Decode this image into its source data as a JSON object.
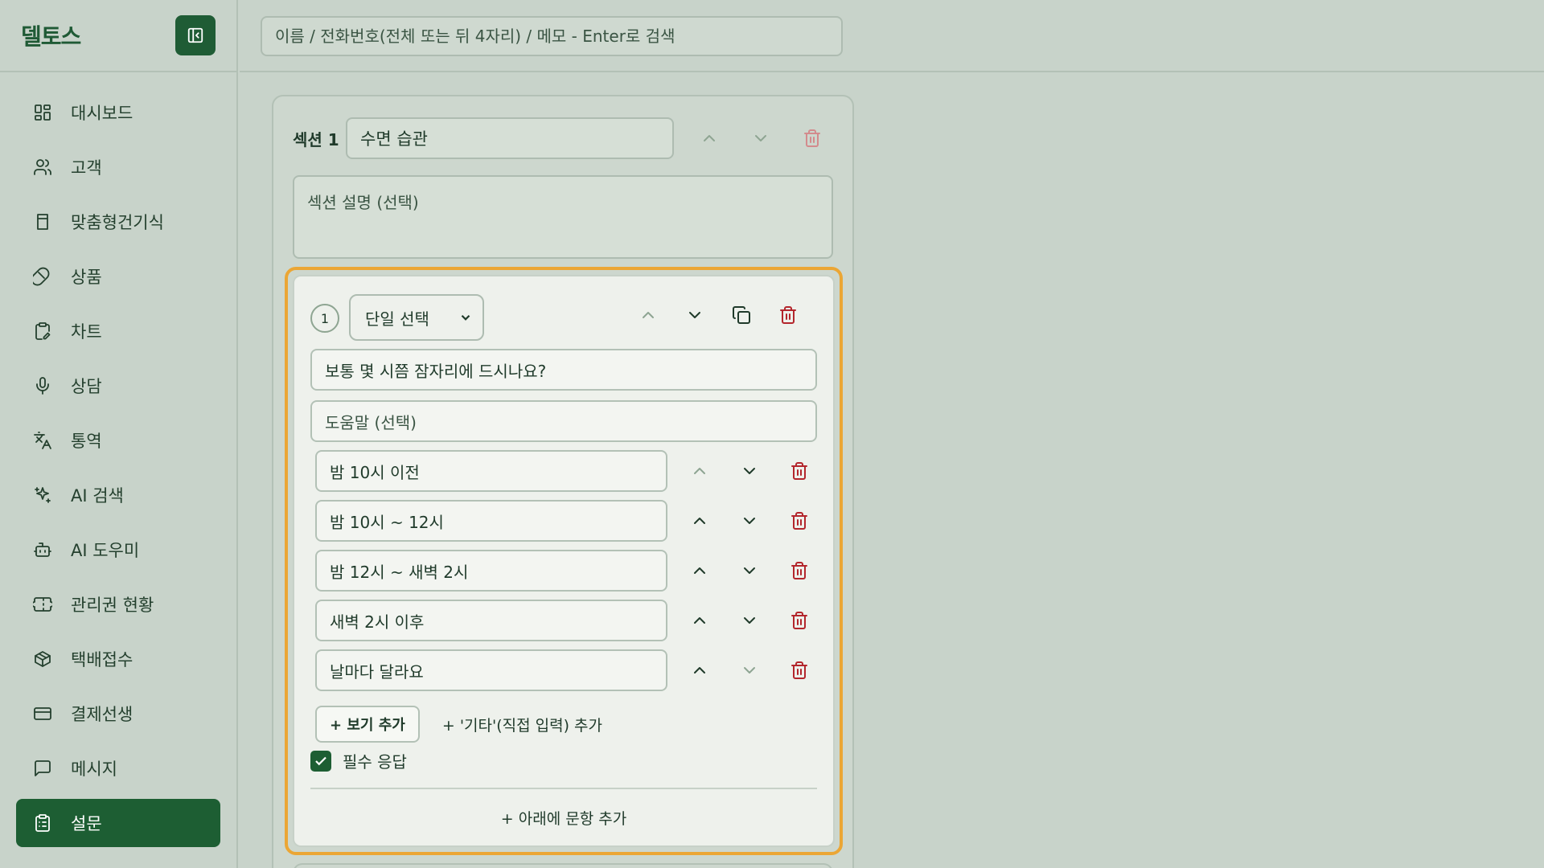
{
  "app": {
    "brand": "델토스"
  },
  "sidebar": {
    "items": [
      {
        "label": "대시보드",
        "icon": "dashboard-icon"
      },
      {
        "label": "고객",
        "icon": "users-icon"
      },
      {
        "label": "맞춤형건기식",
        "icon": "bookmark-icon"
      },
      {
        "label": "상품",
        "icon": "pill-icon"
      },
      {
        "label": "차트",
        "icon": "clipboard-edit-icon"
      },
      {
        "label": "상담",
        "icon": "microphone-icon"
      },
      {
        "label": "통역",
        "icon": "translate-icon"
      },
      {
        "label": "AI 검색",
        "icon": "sparkles-icon"
      },
      {
        "label": "AI 도우미",
        "icon": "bot-icon"
      },
      {
        "label": "관리권 현황",
        "icon": "ticket-icon"
      },
      {
        "label": "택배접수",
        "icon": "package-icon"
      },
      {
        "label": "결제선생",
        "icon": "credit-card-icon"
      },
      {
        "label": "메시지",
        "icon": "message-icon"
      },
      {
        "label": "설문",
        "icon": "clipboard-list-icon",
        "active": true
      }
    ]
  },
  "search": {
    "placeholder": "이름 / 전화번호(전체 또는 뒤 4자리) / 메모 - Enter로 검색"
  },
  "section": {
    "label": "섹션 1",
    "title": "수면 습관",
    "description_placeholder": "섹션 설명 (선택)"
  },
  "question": {
    "number": "1",
    "type": "단일 선택",
    "text": "보통 몇 시쯤 잠자리에 드시나요?",
    "help_placeholder": "도움말 (선택)",
    "options": [
      "밤 10시 이전",
      "밤 10시 ~ 12시",
      "밤 12시 ~ 새벽 2시",
      "새벽 2시 이후",
      "날마다 달라요"
    ],
    "add_option_label": "+ 보기 추가",
    "add_other_label": "+ '기타'(직접 입력) 추가",
    "required_label": "필수 응답",
    "required": true,
    "add_below_label": "+ 아래에 문항 추가"
  },
  "colors": {
    "background": "#c8d3ca",
    "accent": "#1d5e33",
    "highlight_border": "#eba635",
    "danger": "#b3262c"
  }
}
